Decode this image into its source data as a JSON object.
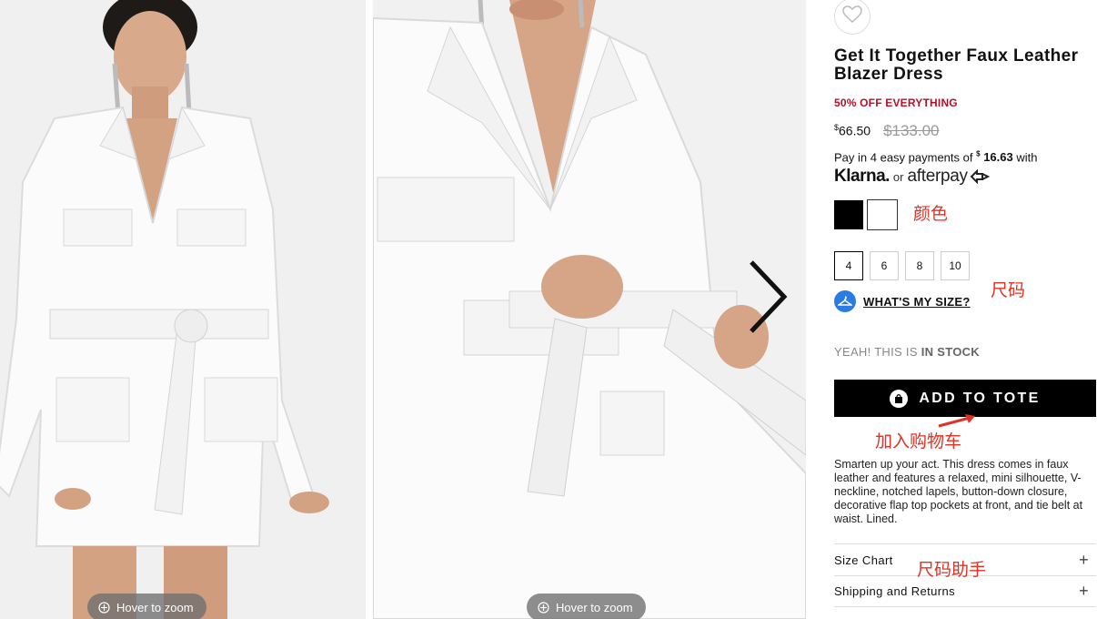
{
  "gallery": {
    "zoom_label": "Hover to zoom"
  },
  "product": {
    "title": "Get It Together Faux Leather Blazer Dress",
    "promo": "50% OFF EVERYTHING",
    "price_currency": "$",
    "price_now": "66.50",
    "price_was": "$133.00",
    "installments_prefix": "Pay in 4 easy payments of",
    "installments_currency": "$",
    "installments_amount": "16.63",
    "installments_suffix": "with",
    "klarna": "Klarna.",
    "or_text": "or",
    "afterpay": "afterpay",
    "colors": [
      "black",
      "white"
    ],
    "sizes": [
      "4",
      "6",
      "8",
      "10"
    ],
    "selected_size": "4",
    "whats_my_size": "WHAT'S MY SIZE?",
    "stock_prefix": "YEAH! THIS IS",
    "stock_status": "IN STOCK",
    "add_to_tote": "ADD TO TOTE",
    "description": "Smarten up your act. This dress comes in faux leather and features a relaxed, mini silhouette, V-neckline, notched lapels, button-down closure, decorative flap top pockets at front, and tie belt at waist. Lined.",
    "accordion": [
      {
        "label": "Size Chart"
      },
      {
        "label": "Shipping and Returns"
      }
    ]
  },
  "annotations": {
    "color": "颜色",
    "size": "尺码",
    "add_to_cart": "加入购物车",
    "size_helper": "尺码助手"
  },
  "colors": {
    "promo": "#b3102a",
    "annotation": "#e03224",
    "button": "#000000",
    "size_help_icon": "#2a7be4"
  },
  "icons": [
    "heart-icon",
    "zoom-icon",
    "chevron-right-icon",
    "hanger-icon",
    "bag-icon",
    "plus-icon"
  ]
}
